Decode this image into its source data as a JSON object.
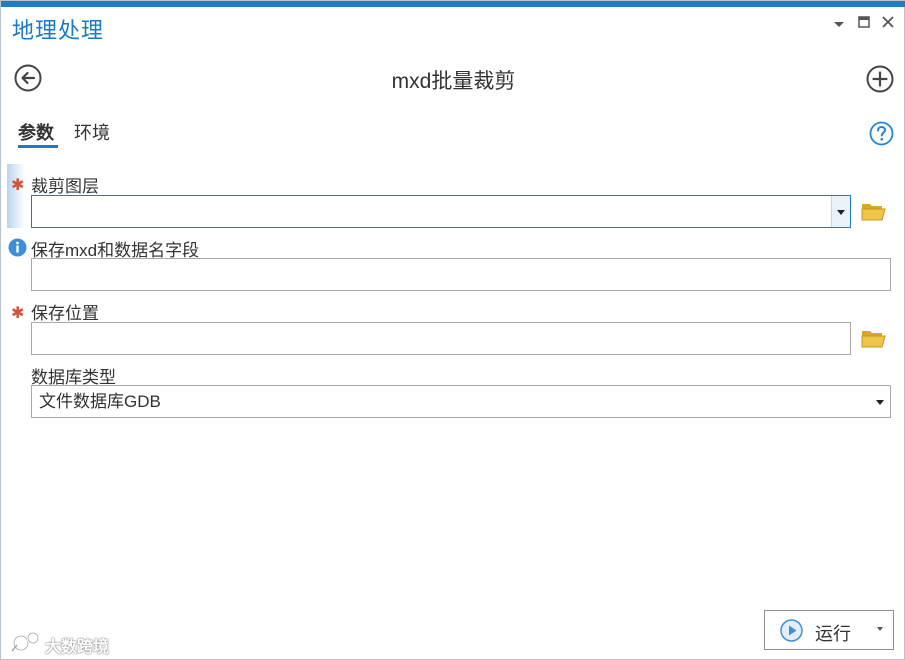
{
  "pane": {
    "title": "地理处理",
    "controls": {
      "menu_icon": "chevron-down-icon",
      "maximize_icon": "maximize-icon",
      "close_icon": "close-icon"
    }
  },
  "tool": {
    "title": "mxd批量裁剪",
    "back_icon": "back-arrow-icon",
    "add_icon": "add-circle-icon"
  },
  "tabs": [
    {
      "label": "参数",
      "active": true
    },
    {
      "label": "环境",
      "active": false
    }
  ],
  "help_icon": "help-icon",
  "parameters": [
    {
      "label": "裁剪图层",
      "required": true,
      "value": "",
      "control": "combo"
    },
    {
      "label": "保存mxd和数据名字段",
      "required": false,
      "info": true,
      "value": "",
      "control": "text"
    },
    {
      "label": "保存位置",
      "required": true,
      "value": "",
      "control": "text"
    },
    {
      "label": "数据库类型",
      "required": false,
      "value": "文件数据库GDB",
      "control": "select"
    }
  ],
  "run_button": {
    "label": "运行",
    "icon": "play-icon"
  },
  "watermark": {
    "text": "大数跨境"
  },
  "colors": {
    "accent": "#1f7bc4",
    "title_blue": "#1b79c8",
    "required": "#d2533a",
    "folder": "#e6b93a"
  }
}
